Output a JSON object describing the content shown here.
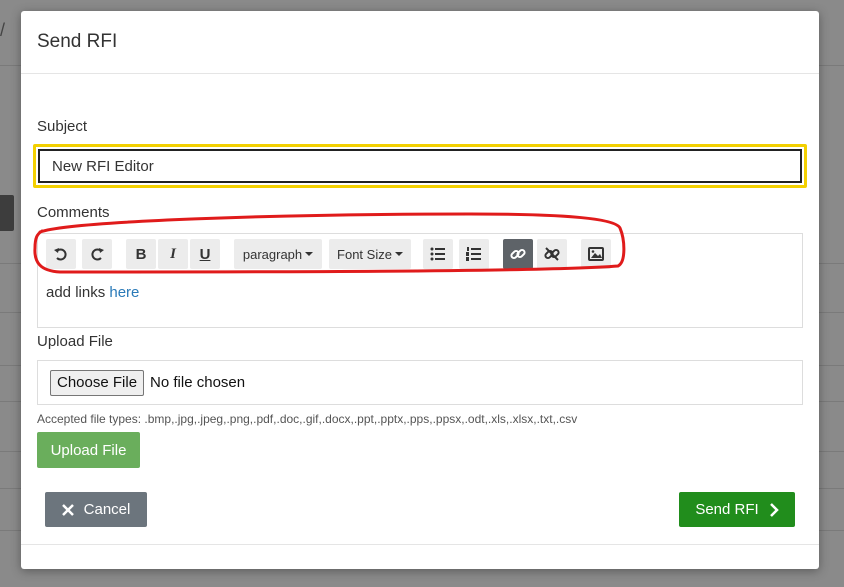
{
  "modal": {
    "title": "Send RFI"
  },
  "subject": {
    "label": "Subject",
    "value": "New RFI Editor"
  },
  "comments": {
    "label": "Comments",
    "toolbar": {
      "undo_icon": "undo-icon",
      "redo_icon": "redo-icon",
      "bold_label": "B",
      "italic_label": "I",
      "underline_label": "U",
      "paragraph_label": "paragraph",
      "font_size_label": "Font Size",
      "bullet_list_icon": "bullet-list-icon",
      "numbered_list_icon": "numbered-list-icon",
      "link_icon": "link-icon",
      "unlink_icon": "unlink-icon",
      "image_icon": "image-icon"
    },
    "body_text": "add links ",
    "body_link": "here"
  },
  "upload": {
    "label": "Upload File",
    "choose_label": "Choose File",
    "no_file_text": "No file chosen",
    "accepted_text": "Accepted file types: .bmp,.jpg,.jpeg,.png,.pdf,.doc,.gif,.docx,.ppt,.pptx,.pps,.ppsx,.odt,.xls,.xlsx,.txt,.csv",
    "upload_button": "Upload File"
  },
  "footer": {
    "cancel_label": "Cancel",
    "send_label": "Send RFI"
  },
  "colors": {
    "highlight_border": "#f3d000",
    "annotation_red": "#e01b1b",
    "send_green": "#218d1c",
    "upload_green": "#6aae5c",
    "cancel_gray": "#6c757d"
  }
}
